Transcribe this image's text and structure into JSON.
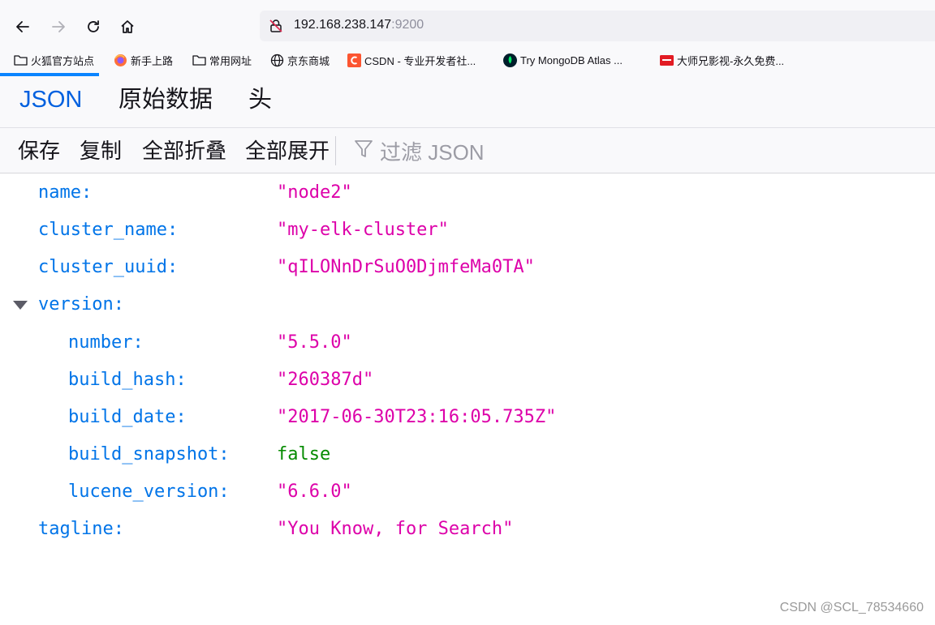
{
  "browser": {
    "url_host": "192.168.238.147",
    "url_port": ":9200"
  },
  "bookmarks": [
    {
      "label": "火狐官方站点",
      "icon": "folder-icon"
    },
    {
      "label": "新手上路",
      "icon": "firefox-icon"
    },
    {
      "label": "常用网址",
      "icon": "folder-icon"
    },
    {
      "label": "京东商城",
      "icon": "globe-icon"
    },
    {
      "label": "CSDN - 专业开发者社...",
      "icon": "csdn-icon"
    },
    {
      "label": "Try MongoDB Atlas ...",
      "icon": "mongodb-leaf-icon"
    },
    {
      "label": "大师兄影视-永久免费...",
      "icon": "site-favicon-icon"
    }
  ],
  "tabs": [
    {
      "label": "JSON",
      "selected": true
    },
    {
      "label": "原始数据",
      "selected": false
    },
    {
      "label": "头",
      "selected": false
    }
  ],
  "toolbar": {
    "save": "保存",
    "copy": "复制",
    "collapse_all": "全部折叠",
    "expand_all": "全部展开",
    "filter_placeholder": "过滤 JSON"
  },
  "json_rows": [
    {
      "key": "name:",
      "value": "\"node2\"",
      "type": "string",
      "depth": 0
    },
    {
      "key": "cluster_name:",
      "value": "\"my-elk-cluster\"",
      "type": "string",
      "depth": 0
    },
    {
      "key": "cluster_uuid:",
      "value": "\"qILONnDrSuO0DjmfeMa0TA\"",
      "type": "string",
      "depth": 0
    },
    {
      "key": "version:",
      "value": "",
      "type": "object",
      "depth": 0,
      "expanded": true
    },
    {
      "key": "number:",
      "value": "\"5.5.0\"",
      "type": "string",
      "depth": 1
    },
    {
      "key": "build_hash:",
      "value": "\"260387d\"",
      "type": "string",
      "depth": 1
    },
    {
      "key": "build_date:",
      "value": "\"2017-06-30T23:16:05.735Z\"",
      "type": "string",
      "depth": 1
    },
    {
      "key": "build_snapshot:",
      "value": "false",
      "type": "boolean",
      "depth": 1
    },
    {
      "key": "lucene_version:",
      "value": "\"6.6.0\"",
      "type": "string",
      "depth": 1
    },
    {
      "key": "tagline:",
      "value": "\"You Know, for Search\"",
      "type": "string",
      "depth": 0
    }
  ],
  "watermark": "CSDN @SCL_78534660",
  "colors": {
    "accent": "#0060df",
    "key": "#0074e8",
    "string": "#dd00a9",
    "boolean": "#058b00"
  }
}
